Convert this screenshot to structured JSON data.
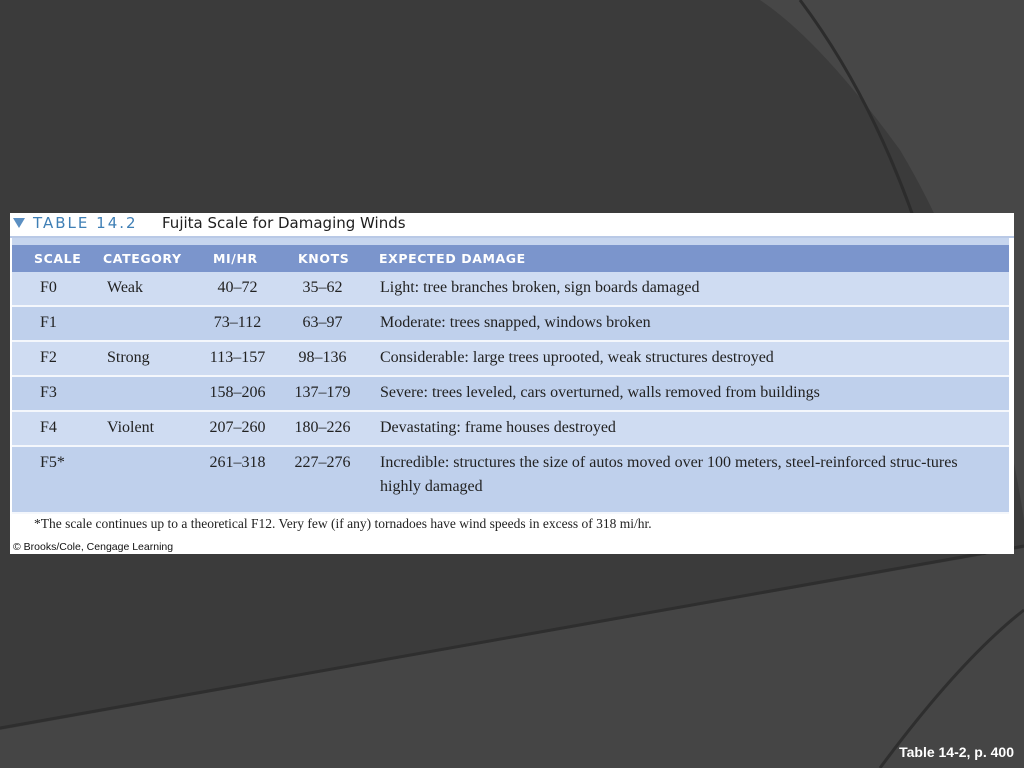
{
  "slide": {
    "background_color": "#3a3a3a",
    "caption": "Table 14-2, p. 400"
  },
  "table": {
    "number": "TABLE 14.2",
    "title": "Fujita Scale for Damaging Winds",
    "accent_color": "#3f7fb5",
    "header_color": "#7b95cc",
    "columns": [
      "SCALE",
      "CATEGORY",
      "MI/HR",
      "KNOTS",
      "EXPECTED DAMAGE"
    ],
    "rows": [
      {
        "scale": "F0",
        "category": "Weak",
        "mph": "40–72",
        "knots": "35–62",
        "damage": "Light: tree branches broken, sign boards damaged"
      },
      {
        "scale": "F1",
        "category": "",
        "mph": "73–112",
        "knots": "63–97",
        "damage": "Moderate: trees snapped, windows broken"
      },
      {
        "scale": "F2",
        "category": "Strong",
        "mph": "113–157",
        "knots": "98–136",
        "damage": "Considerable: large trees uprooted, weak structures destroyed"
      },
      {
        "scale": "F3",
        "category": "",
        "mph": "158–206",
        "knots": "137–179",
        "damage": "Severe: trees leveled, cars overturned, walls removed from buildings"
      },
      {
        "scale": "F4",
        "category": "Violent",
        "mph": "207–260",
        "knots": "180–226",
        "damage": "Devastating: frame houses destroyed"
      },
      {
        "scale": "F5*",
        "category": "",
        "mph": "261–318",
        "knots": "227–276",
        "damage": "Incredible: structures the size of autos moved over 100 meters, steel-reinforced struc-tures highly damaged"
      }
    ],
    "footnote": "*The scale continues up to a theoretical F12. Very few (if any) tornadoes have wind speeds in excess of 318 mi/hr.",
    "credit": "© Brooks/Cole, Cengage Learning"
  }
}
